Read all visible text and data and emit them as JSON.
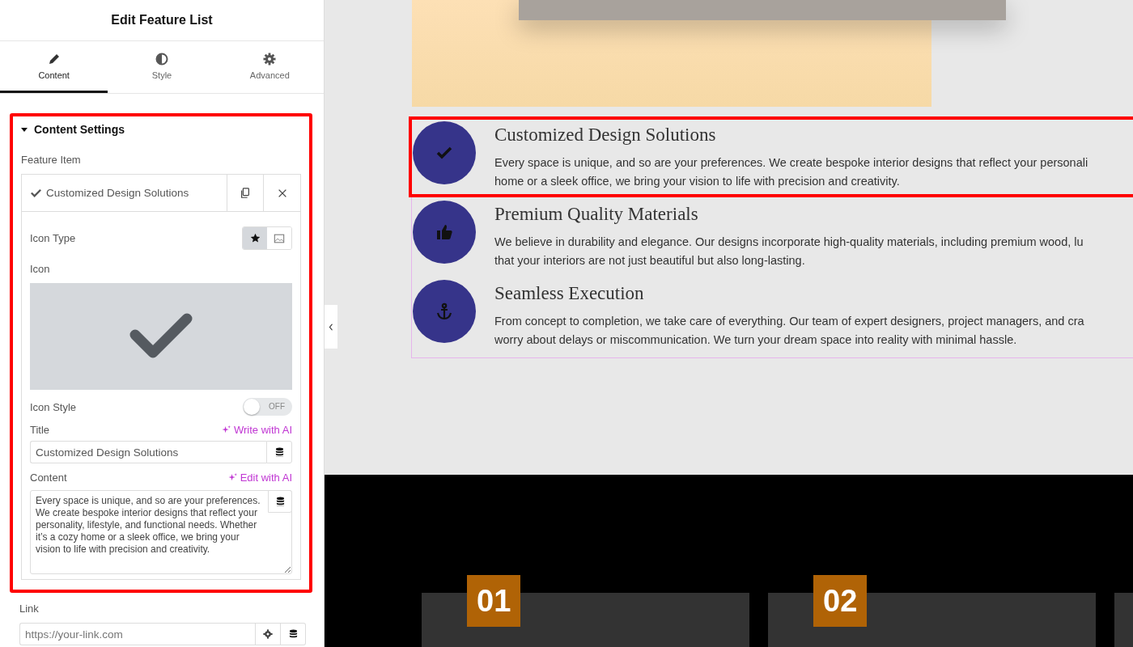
{
  "panel": {
    "title": "Edit Feature List",
    "tabs": [
      {
        "label": "Content",
        "selected": true
      },
      {
        "label": "Style",
        "selected": false
      },
      {
        "label": "Advanced",
        "selected": false
      }
    ],
    "section": {
      "title": "Content Settings",
      "expanded": true,
      "highlighted": true,
      "group_label": "Feature Item",
      "item": {
        "title": "Customized Design Solutions",
        "expanded": true
      },
      "icon_type": {
        "label": "Icon Type",
        "options": [
          {
            "kind": "icon",
            "selected": true
          },
          {
            "kind": "image",
            "selected": false
          }
        ]
      },
      "icon_label": "Icon",
      "icon_style": {
        "label": "Icon Style",
        "on": false,
        "state_text": "OFF"
      },
      "title_field": {
        "label": "Title",
        "ai_link": "Write with AI",
        "value": "Customized Design Solutions"
      },
      "content_field": {
        "label": "Content",
        "ai_link": "Edit with AI",
        "value": "Every space is unique, and so are your preferences. We create bespoke interior designs that reflect your personality, lifestyle, and functional needs. Whether it’s a cozy home or a sleek office, we bring your vision to life with precision and creativity."
      }
    },
    "link_field": {
      "label": "Link",
      "placeholder": "https://your-link.com"
    }
  },
  "canvas": {
    "features": [
      {
        "highlighted": true,
        "title": "Customized Design Solutions",
        "lines": [
          "Every space is unique, and so are your preferences. We create bespoke interior designs that reflect your personali",
          "home or a sleek office, we bring your vision to life with precision and creativity."
        ]
      },
      {
        "highlighted": false,
        "title": "Premium Quality Materials",
        "lines": [
          "We believe in durability and elegance. Our designs incorporate high-quality materials, including premium wood, lu",
          "that your interiors are not just beautiful but also long-lasting."
        ]
      },
      {
        "highlighted": false,
        "title": "Seamless Execution",
        "lines": [
          "From concept to completion, we take care of everything. Our team of expert designers, project managers, and cra",
          "worry about delays or miscommunication. We turn your dream space into reality with minimal hassle."
        ]
      }
    ],
    "cards": [
      {
        "number": "01"
      },
      {
        "number": "02"
      }
    ]
  }
}
